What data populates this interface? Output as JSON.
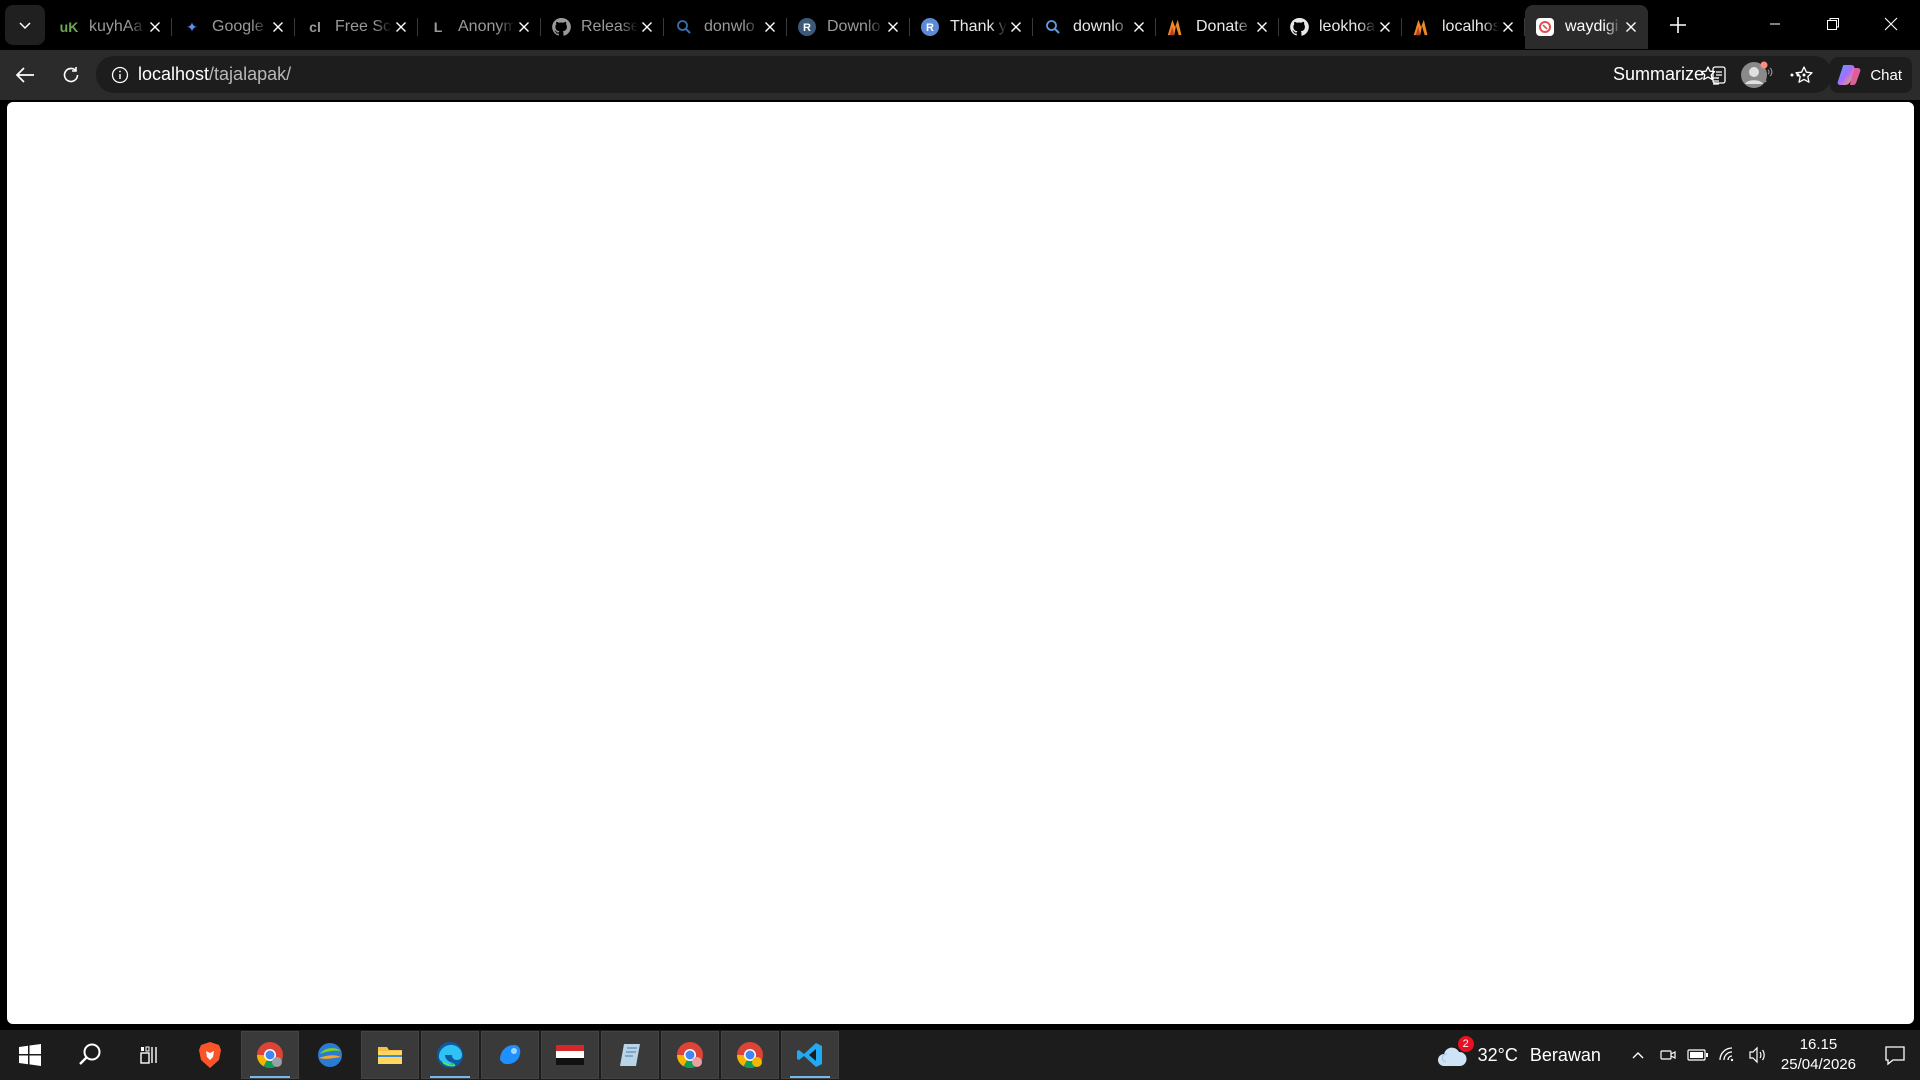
{
  "browser": {
    "tabs": [
      {
        "title": "kuyhAa",
        "favicon": "kuyhaa-icon",
        "fav_glyph": "uK",
        "fav_color": "#6aa84f",
        "bright": false
      },
      {
        "title": "Google",
        "favicon": "gemini-icon",
        "fav_glyph": "✦",
        "fav_color": "#5b8def",
        "bright": false
      },
      {
        "title": "Free Scr",
        "favicon": "cl-icon",
        "fav_glyph": "cl",
        "fav_color": "#9a9a9a",
        "bright": false
      },
      {
        "title": "Anonym",
        "favicon": "l-icon",
        "fav_glyph": "L",
        "fav_color": "#9a9a9a",
        "bright": false
      },
      {
        "title": "Release",
        "favicon": "github-icon",
        "fav_glyph": "",
        "fav_color": "#9a9a9a",
        "bright": false
      },
      {
        "title": "donwlo",
        "favicon": "search-icon",
        "fav_glyph": "",
        "fav_color": "#3b6ea5",
        "bright": false
      },
      {
        "title": "Downlo",
        "favicon": "r-circle-icon",
        "fav_glyph": "R",
        "fav_color": "#3b5a7a",
        "bright": false
      },
      {
        "title": "Thank y",
        "favicon": "r-circle-icon",
        "fav_glyph": "R",
        "fav_color": "#5b8ad6",
        "bright": true
      },
      {
        "title": "downlo",
        "favicon": "search-icon",
        "fav_glyph": "",
        "fav_color": "#5b9be6",
        "bright": true
      },
      {
        "title": "Donate",
        "favicon": "xampp-icon",
        "fav_glyph": "",
        "fav_color": "#f08a24",
        "bright": true
      },
      {
        "title": "leokhoa",
        "favicon": "github-icon",
        "fav_glyph": "",
        "fav_color": "#e8e8e8",
        "bright": true
      },
      {
        "title": "localhos",
        "favicon": "xampp-icon",
        "fav_glyph": "",
        "fav_color": "#f08a24",
        "bright": true
      },
      {
        "title": "waydigi",
        "favicon": "app-icon",
        "fav_glyph": "",
        "fav_color": "#e05050",
        "bright": true,
        "active": true
      }
    ],
    "url_host": "localhost",
    "url_path": "/tajalapak/",
    "summarize_label": "Summarize",
    "chat_label": "Chat"
  },
  "taskbar": {
    "weather_badge": "2",
    "temperature": "32°C",
    "condition": "Berawan",
    "time": "16.15",
    "date": "25/04/2026"
  },
  "colors": {
    "tabstrip": "#000000",
    "toolbar": "#2b2b2b",
    "omnibox": "#1d1d1d",
    "taskbar": "#1c1c1c",
    "viewport": "#ffffff"
  }
}
